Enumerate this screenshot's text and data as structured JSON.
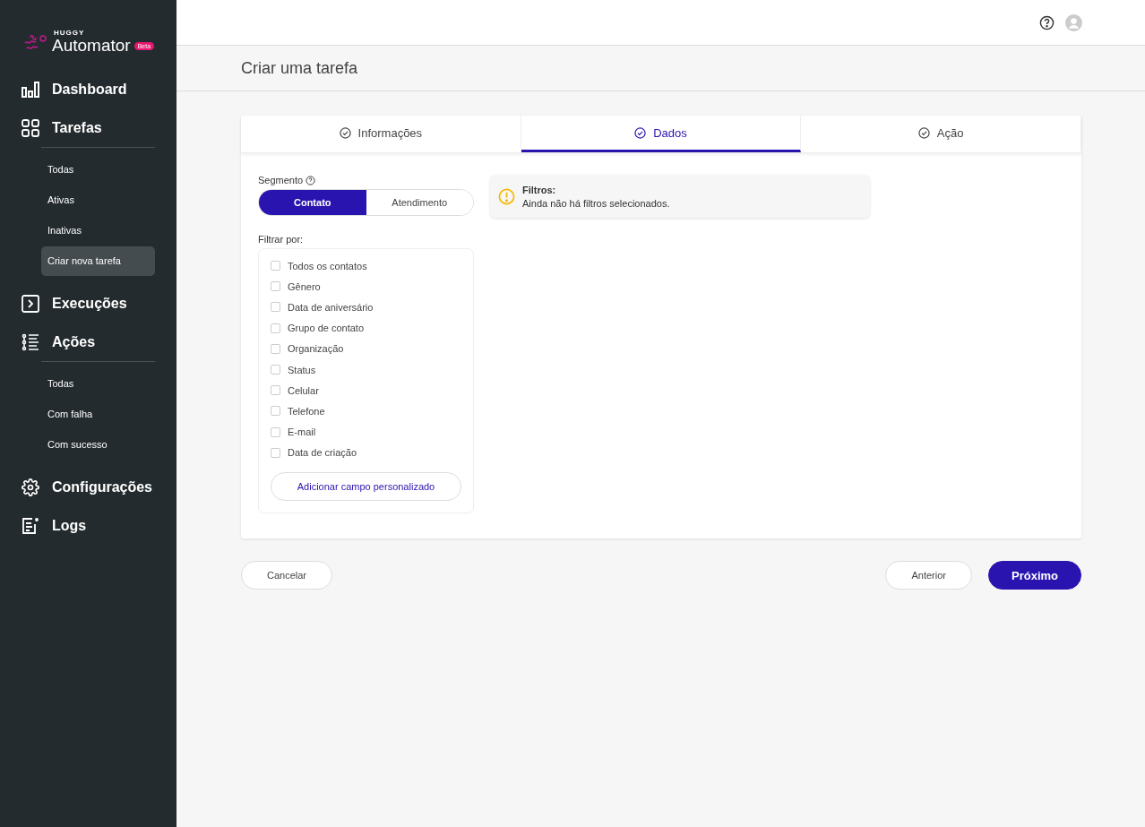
{
  "logo": {
    "brand": "HUGGY",
    "product": "Automator",
    "badge": "Beta"
  },
  "sidebar": {
    "items": [
      {
        "label": "Dashboard"
      },
      {
        "label": "Tarefas",
        "children": [
          {
            "label": "Todas",
            "selected": false
          },
          {
            "label": "Ativas",
            "selected": false
          },
          {
            "label": "Inativas",
            "selected": false
          },
          {
            "label": "Criar nova tarefa",
            "selected": true
          }
        ]
      },
      {
        "label": "Execuções"
      },
      {
        "label": "Ações",
        "children": [
          {
            "label": "Todas",
            "selected": false
          },
          {
            "label": "Com falha",
            "selected": false
          },
          {
            "label": "Com sucesso",
            "selected": false
          }
        ]
      },
      {
        "label": "Configurações"
      },
      {
        "label": "Logs"
      }
    ]
  },
  "page_title": "Criar uma tarefa",
  "tabs": [
    {
      "label": "Informações",
      "selected": false
    },
    {
      "label": "Dados",
      "selected": true
    },
    {
      "label": "Ação",
      "selected": false
    }
  ],
  "segment": {
    "label": "Segmento",
    "options": [
      {
        "label": "Contato",
        "selected": true
      },
      {
        "label": "Atendimento",
        "selected": false
      }
    ]
  },
  "filter": {
    "label": "Filtrar por:",
    "options": [
      {
        "label": "Todos os contatos",
        "checked": false
      },
      {
        "label": "Gênero",
        "checked": false
      },
      {
        "label": "Data de aniversário",
        "checked": false
      },
      {
        "label": "Grupo de contato",
        "checked": false
      },
      {
        "label": "Organização",
        "checked": false
      },
      {
        "label": "Status",
        "checked": false
      },
      {
        "label": "Celular",
        "checked": false
      },
      {
        "label": "Telefone",
        "checked": false
      },
      {
        "label": "E-mail",
        "checked": false
      },
      {
        "label": "Data de criação",
        "checked": false
      }
    ],
    "add_button": "Adicionar campo personalizado"
  },
  "alert": {
    "title": "Filtros:",
    "text": "Ainda não há filtros selecionados."
  },
  "footer": {
    "cancel": "Cancelar",
    "previous": "Anterior",
    "next": "Próximo"
  }
}
